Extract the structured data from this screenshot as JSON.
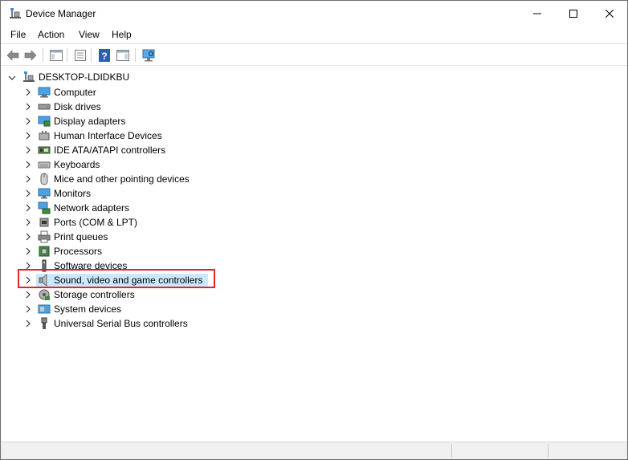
{
  "window": {
    "title": "Device Manager",
    "controls": {
      "minimize": "minimize",
      "maximize": "maximize",
      "close": "close"
    }
  },
  "menu": [
    "File",
    "Action",
    "View",
    "Help"
  ],
  "toolbar": {
    "buttons": [
      "back-icon",
      "forward-icon",
      "show-hide-console-tree-icon",
      "properties-icon",
      "help-icon",
      "action-pane-icon",
      "scan-hardware-icon"
    ]
  },
  "tree": {
    "root": "DESKTOP-LDIDKBU",
    "categories": [
      {
        "label": "Computer",
        "icon": "computer-icon"
      },
      {
        "label": "Disk drives",
        "icon": "disk-drive-icon"
      },
      {
        "label": "Display adapters",
        "icon": "display-adapter-icon"
      },
      {
        "label": "Human Interface Devices",
        "icon": "hid-icon"
      },
      {
        "label": "IDE ATA/ATAPI controllers",
        "icon": "ide-controller-icon"
      },
      {
        "label": "Keyboards",
        "icon": "keyboard-icon"
      },
      {
        "label": "Mice and other pointing devices",
        "icon": "mouse-icon"
      },
      {
        "label": "Monitors",
        "icon": "monitor-icon"
      },
      {
        "label": "Network adapters",
        "icon": "network-adapter-icon"
      },
      {
        "label": "Ports (COM & LPT)",
        "icon": "port-icon"
      },
      {
        "label": "Print queues",
        "icon": "printer-icon"
      },
      {
        "label": "Processors",
        "icon": "processor-icon"
      },
      {
        "label": "Software devices",
        "icon": "software-device-icon"
      },
      {
        "label": "Sound, video and game controllers",
        "icon": "speaker-icon",
        "selected": true
      },
      {
        "label": "Storage controllers",
        "icon": "storage-controller-icon"
      },
      {
        "label": "System devices",
        "icon": "system-devices-icon"
      },
      {
        "label": "Universal Serial Bus controllers",
        "icon": "usb-icon"
      }
    ]
  },
  "colors": {
    "selection": "#cce8ff",
    "highlight_border": "#e0262b"
  }
}
